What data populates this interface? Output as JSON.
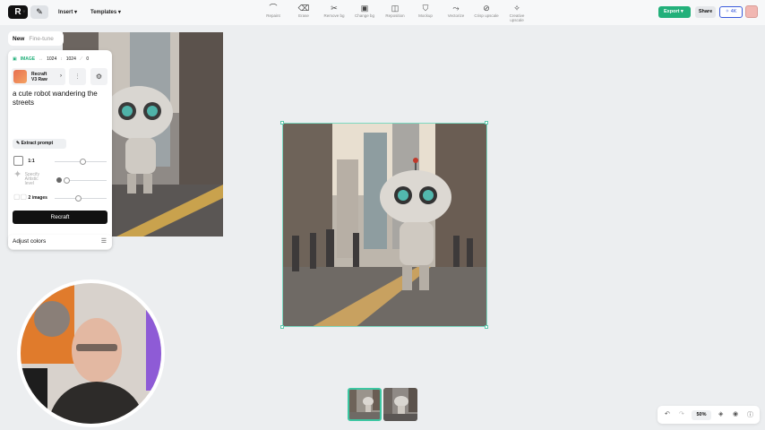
{
  "header": {
    "logo_text": "R",
    "menu": [
      "Insert",
      "Templates"
    ],
    "tools": [
      {
        "label": "Repaint",
        "icon": "lasso-icon"
      },
      {
        "label": "Erase",
        "icon": "eraser-icon"
      },
      {
        "label": "Remove bg",
        "icon": "scissors-icon"
      },
      {
        "label": "Change bg",
        "icon": "image-swap-icon"
      },
      {
        "label": "Reposition",
        "icon": "reposition-icon"
      },
      {
        "label": "Mockup",
        "icon": "shirt-icon"
      },
      {
        "label": "Vectorize",
        "icon": "vector-icon"
      },
      {
        "label": "Crisp upscale",
        "icon": "upscale-icon"
      },
      {
        "label": "Creative upscale",
        "icon": "creative-upscale-icon"
      }
    ],
    "export_label": "Export",
    "share_label": "Share",
    "quality_label": "4K"
  },
  "panel": {
    "tabs": [
      "New",
      "Fine-tune"
    ],
    "type_tag": "IMAGE",
    "width": "1024",
    "height": "1024",
    "variant": "0",
    "model": [
      "Recraft",
      "V3 Raw"
    ],
    "prompt": "a cute robot wandering the streets",
    "extract_label": "Extract prompt",
    "ratio": "1:1",
    "artistic_label": [
      "Specify",
      "Artistic",
      "level"
    ],
    "count_label": "2 images",
    "recraft_label": "Recraft",
    "adjust_label": "Adjust colors"
  },
  "footer": {
    "zoom": "50%"
  },
  "colors": {
    "accent": "#22b07a",
    "selection": "#5cc9ac",
    "primary_button": "#111111"
  }
}
